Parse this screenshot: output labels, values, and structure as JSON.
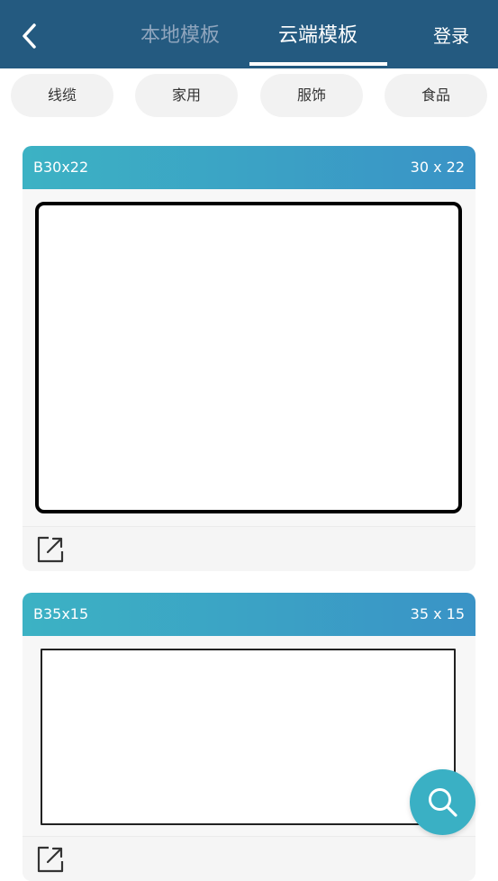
{
  "header": {
    "tabs": [
      {
        "label": "本地模板",
        "active": false
      },
      {
        "label": "云端模板",
        "active": true
      }
    ],
    "login_label": "登录",
    "background_color": "#245a80"
  },
  "categories": [
    "线缆",
    "家用",
    "服饰",
    "食品"
  ],
  "templates": [
    {
      "name": "B30x22",
      "size": "30 x 22"
    },
    {
      "name": "B35x15",
      "size": "35 x 15"
    }
  ],
  "colors": {
    "accent": "#3ab0c4",
    "header_gradient_start": "#3cb2c4",
    "header_gradient_end": "#3a93c6"
  },
  "icons": {
    "back": "chevron-left-icon",
    "share": "share-external-icon",
    "search": "search-icon"
  }
}
